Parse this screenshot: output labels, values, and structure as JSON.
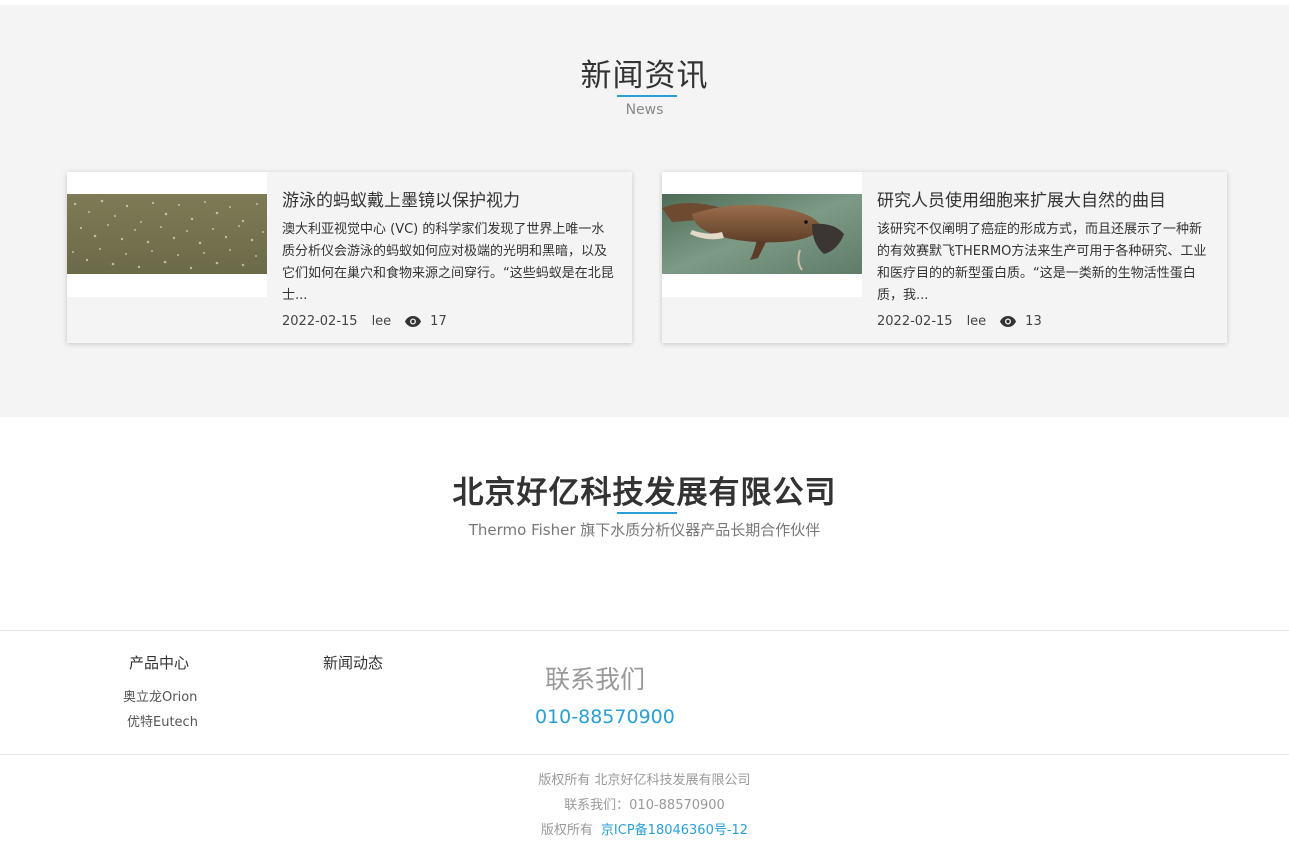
{
  "news_section": {
    "title": "新闻资讯",
    "subtitle": "News",
    "articles": [
      {
        "title": "游泳的蚂蚁戴上墨镜以保护视力",
        "summary": "澳大利亚视觉中心 (VC) 的科学家们发现了世界上唯一水质分析仪会游泳的蚂蚁如何应对极端的光明和黑暗，以及它们如何在巢穴和食物来源之间穿行。“这些蚂蚁是在北昆士...",
        "date": "2022-02-15",
        "author": "lee",
        "views": "17",
        "image": "ant-swarm-photo"
      },
      {
        "title": "研究人员使用细胞来扩展大自然的曲目",
        "summary": "该研究不仅阐明了癌症的形成方式，而且还展示了一种新的有效赛默飞THERMO方法来生产可用于各种研究、工业和医疗目的的新型蛋白质。“这是一类新的生物活性蛋白质，我...",
        "date": "2022-02-15",
        "author": "lee",
        "views": "13",
        "image": "platypus-photo"
      }
    ]
  },
  "company": {
    "name": "北京好亿科技发展有限公司",
    "tagline": "Thermo Fisher 旗下水质分析仪器产品长期合作伙伴"
  },
  "footer": {
    "products_title": "产品中心",
    "product_links": [
      "奥立龙Orion",
      "优特Eutech"
    ],
    "news_title": "新闻动态",
    "contact_title": "联系我们",
    "contact_phone": "010-88570900",
    "copyright_line": "版权所有 北京好亿科技发展有限公司",
    "contact_line": "联系我们：010-88570900",
    "icp_prefix": "版权所有",
    "icp_link": "京ICP备18046360号-12"
  },
  "colors": {
    "accent": "#2a9fd6",
    "section_bg": "#f4f4f4"
  }
}
